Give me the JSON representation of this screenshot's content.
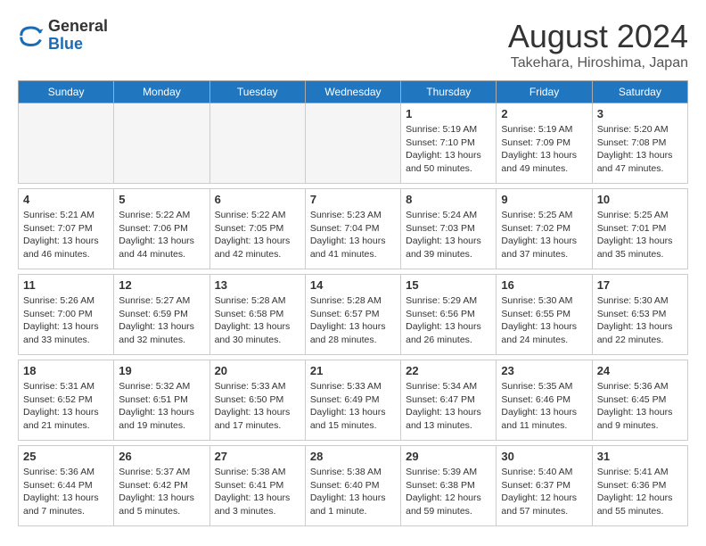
{
  "header": {
    "logo_general": "General",
    "logo_blue": "Blue",
    "title": "August 2024",
    "subtitle": "Takehara, Hiroshima, Japan"
  },
  "days_of_week": [
    "Sunday",
    "Monday",
    "Tuesday",
    "Wednesday",
    "Thursday",
    "Friday",
    "Saturday"
  ],
  "weeks": [
    [
      {
        "date": "",
        "info": ""
      },
      {
        "date": "",
        "info": ""
      },
      {
        "date": "",
        "info": ""
      },
      {
        "date": "",
        "info": ""
      },
      {
        "date": "1",
        "info": "Sunrise: 5:19 AM\nSunset: 7:10 PM\nDaylight: 13 hours\nand 50 minutes."
      },
      {
        "date": "2",
        "info": "Sunrise: 5:19 AM\nSunset: 7:09 PM\nDaylight: 13 hours\nand 49 minutes."
      },
      {
        "date": "3",
        "info": "Sunrise: 5:20 AM\nSunset: 7:08 PM\nDaylight: 13 hours\nand 47 minutes."
      }
    ],
    [
      {
        "date": "4",
        "info": "Sunrise: 5:21 AM\nSunset: 7:07 PM\nDaylight: 13 hours\nand 46 minutes."
      },
      {
        "date": "5",
        "info": "Sunrise: 5:22 AM\nSunset: 7:06 PM\nDaylight: 13 hours\nand 44 minutes."
      },
      {
        "date": "6",
        "info": "Sunrise: 5:22 AM\nSunset: 7:05 PM\nDaylight: 13 hours\nand 42 minutes."
      },
      {
        "date": "7",
        "info": "Sunrise: 5:23 AM\nSunset: 7:04 PM\nDaylight: 13 hours\nand 41 minutes."
      },
      {
        "date": "8",
        "info": "Sunrise: 5:24 AM\nSunset: 7:03 PM\nDaylight: 13 hours\nand 39 minutes."
      },
      {
        "date": "9",
        "info": "Sunrise: 5:25 AM\nSunset: 7:02 PM\nDaylight: 13 hours\nand 37 minutes."
      },
      {
        "date": "10",
        "info": "Sunrise: 5:25 AM\nSunset: 7:01 PM\nDaylight: 13 hours\nand 35 minutes."
      }
    ],
    [
      {
        "date": "11",
        "info": "Sunrise: 5:26 AM\nSunset: 7:00 PM\nDaylight: 13 hours\nand 33 minutes."
      },
      {
        "date": "12",
        "info": "Sunrise: 5:27 AM\nSunset: 6:59 PM\nDaylight: 13 hours\nand 32 minutes."
      },
      {
        "date": "13",
        "info": "Sunrise: 5:28 AM\nSunset: 6:58 PM\nDaylight: 13 hours\nand 30 minutes."
      },
      {
        "date": "14",
        "info": "Sunrise: 5:28 AM\nSunset: 6:57 PM\nDaylight: 13 hours\nand 28 minutes."
      },
      {
        "date": "15",
        "info": "Sunrise: 5:29 AM\nSunset: 6:56 PM\nDaylight: 13 hours\nand 26 minutes."
      },
      {
        "date": "16",
        "info": "Sunrise: 5:30 AM\nSunset: 6:55 PM\nDaylight: 13 hours\nand 24 minutes."
      },
      {
        "date": "17",
        "info": "Sunrise: 5:30 AM\nSunset: 6:53 PM\nDaylight: 13 hours\nand 22 minutes."
      }
    ],
    [
      {
        "date": "18",
        "info": "Sunrise: 5:31 AM\nSunset: 6:52 PM\nDaylight: 13 hours\nand 21 minutes."
      },
      {
        "date": "19",
        "info": "Sunrise: 5:32 AM\nSunset: 6:51 PM\nDaylight: 13 hours\nand 19 minutes."
      },
      {
        "date": "20",
        "info": "Sunrise: 5:33 AM\nSunset: 6:50 PM\nDaylight: 13 hours\nand 17 minutes."
      },
      {
        "date": "21",
        "info": "Sunrise: 5:33 AM\nSunset: 6:49 PM\nDaylight: 13 hours\nand 15 minutes."
      },
      {
        "date": "22",
        "info": "Sunrise: 5:34 AM\nSunset: 6:47 PM\nDaylight: 13 hours\nand 13 minutes."
      },
      {
        "date": "23",
        "info": "Sunrise: 5:35 AM\nSunset: 6:46 PM\nDaylight: 13 hours\nand 11 minutes."
      },
      {
        "date": "24",
        "info": "Sunrise: 5:36 AM\nSunset: 6:45 PM\nDaylight: 13 hours\nand 9 minutes."
      }
    ],
    [
      {
        "date": "25",
        "info": "Sunrise: 5:36 AM\nSunset: 6:44 PM\nDaylight: 13 hours\nand 7 minutes."
      },
      {
        "date": "26",
        "info": "Sunrise: 5:37 AM\nSunset: 6:42 PM\nDaylight: 13 hours\nand 5 minutes."
      },
      {
        "date": "27",
        "info": "Sunrise: 5:38 AM\nSunset: 6:41 PM\nDaylight: 13 hours\nand 3 minutes."
      },
      {
        "date": "28",
        "info": "Sunrise: 5:38 AM\nSunset: 6:40 PM\nDaylight: 13 hours\nand 1 minute."
      },
      {
        "date": "29",
        "info": "Sunrise: 5:39 AM\nSunset: 6:38 PM\nDaylight: 12 hours\nand 59 minutes."
      },
      {
        "date": "30",
        "info": "Sunrise: 5:40 AM\nSunset: 6:37 PM\nDaylight: 12 hours\nand 57 minutes."
      },
      {
        "date": "31",
        "info": "Sunrise: 5:41 AM\nSunset: 6:36 PM\nDaylight: 12 hours\nand 55 minutes."
      }
    ]
  ]
}
